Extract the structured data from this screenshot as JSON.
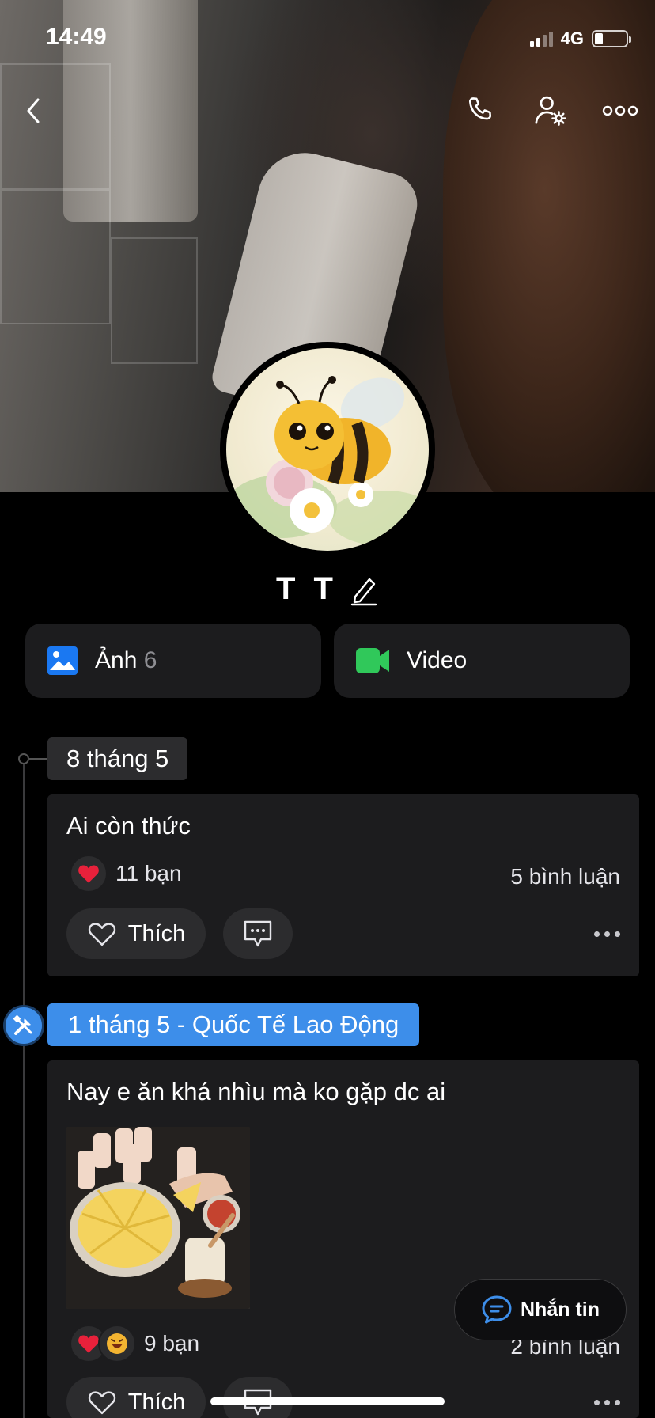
{
  "status_bar": {
    "time": "14:49",
    "network": "4G"
  },
  "profile": {
    "name": "T T"
  },
  "media": {
    "photos_label": "Ảnh",
    "photos_count": "6",
    "video_label": "Video"
  },
  "timeline": {
    "date_1": "8 tháng 5",
    "post_1": {
      "text": "Ai còn thức",
      "reactions": "11 bạn",
      "comments": "5 bình luận",
      "like_label": "Thích"
    },
    "event_chip": "1 tháng 5 - Quốc Tế Lao Động",
    "post_2": {
      "text": "Nay e ăn khá nhìu mà ko gặp dc ai",
      "reactions": "9 bạn",
      "comments": "2 bình luận",
      "like_label": "Thích"
    }
  },
  "fab": {
    "label": "Nhắn tin"
  },
  "colors": {
    "accent": "#3d8eea",
    "video_green": "#30c85a",
    "photo_blue": "#1a78f2",
    "heart": "#e8213b"
  },
  "icons": [
    "back-icon",
    "phone-icon",
    "user-settings-icon",
    "more-icon",
    "edit-icon",
    "photo-icon",
    "video-icon",
    "heart-icon",
    "comment-icon",
    "tools-icon",
    "message-icon"
  ]
}
